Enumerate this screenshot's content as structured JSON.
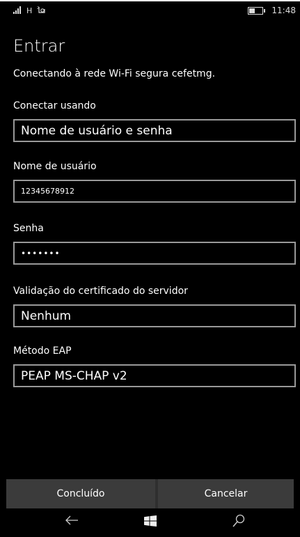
{
  "status": {
    "network": "H",
    "time": "11:48",
    "battery_level": 0.45
  },
  "page": {
    "title": "Entrar",
    "description": "Conectando à rede Wi-Fi segura cefetmg."
  },
  "form": {
    "connect_using": {
      "label": "Conectar usando",
      "value": "Nome de usuário e senha"
    },
    "username": {
      "label": "Nome de usuário",
      "value": "12345678912"
    },
    "password": {
      "label": "Senha",
      "value": "•••••••"
    },
    "cert_validation": {
      "label": "Validação do certificado do servidor",
      "value": "Nenhum"
    },
    "eap_method": {
      "label": "Método EAP",
      "value": "PEAP MS-CHAP v2"
    }
  },
  "commands": {
    "done": "Concluído",
    "cancel": "Cancelar"
  },
  "nav": {
    "back_icon": "back-arrow-icon",
    "start_icon": "windows-logo-icon",
    "search_icon": "search-icon"
  }
}
